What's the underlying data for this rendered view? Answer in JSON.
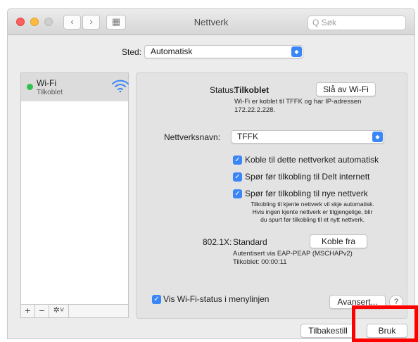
{
  "window": {
    "title": "Nettverk",
    "nav_back": "‹",
    "nav_forward": "›",
    "grid_icon": "▦",
    "search_placeholder": "Q Søk"
  },
  "location": {
    "label": "Sted:",
    "value": "Automatisk"
  },
  "sidebar": {
    "items": [
      {
        "name": "Wi-Fi",
        "status": "Tilkoblet",
        "icon": "wifi-icon",
        "status_color": "#2fc250"
      }
    ],
    "add_label": "+",
    "remove_label": "−",
    "action_label": "✲˅"
  },
  "status": {
    "label": "Status:",
    "value": "Tilkoblet",
    "button": "Slå av Wi-Fi",
    "description_line1": "Wi-Fi er koblet til TFFK og har IP-adressen",
    "description_line2": "172.22.2.228."
  },
  "network_name": {
    "label": "Nettverksnavn:",
    "value": "TFFK"
  },
  "options": [
    {
      "label": "Koble til dette nettverket automatisk",
      "checked": true
    },
    {
      "label": "Spør før tilkobling til Delt internett",
      "checked": true
    },
    {
      "label": "Spør før tilkobling til nye nettverk",
      "checked": true
    }
  ],
  "options_note": {
    "line1": "Tilkobling til kjente nettverk vil skje automatisk.",
    "line2": "Hvis ingen kjente nettverk er tilgjengelige, blir",
    "line3": "du spurt før tilkobling til et nytt nettverk."
  },
  "auth": {
    "label": "802.1X:",
    "value": "Standard",
    "button": "Koble fra",
    "detail_line1": "Autentisert via EAP-PEAP (MSCHAPv2)",
    "detail_line2": "Tilkoblet: 00:00:11"
  },
  "menubar_option": {
    "label": "Vis Wi-Fi-status i menylinjen",
    "checked": true
  },
  "advanced_button": "Avansert...",
  "help_button": "?",
  "footer": {
    "revert_button": "Tilbakestill",
    "apply_button": "Bruk"
  },
  "accent_color": "#3b86f7",
  "highlight_color": "#ff0000"
}
